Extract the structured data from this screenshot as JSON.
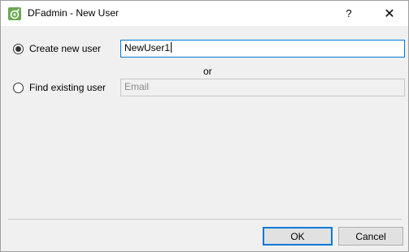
{
  "window": {
    "title": "DFadmin - New User",
    "help_glyph": "?",
    "close_glyph": "✕"
  },
  "options": {
    "create": {
      "label": "Create new user",
      "value": "NewUser1",
      "selected": true
    },
    "separator": "or",
    "find": {
      "label": "Find existing user",
      "placeholder": "Email",
      "selected": false
    }
  },
  "buttons": {
    "ok": "OK",
    "cancel": "Cancel"
  },
  "icons": {
    "app": "dfadmin-app-icon",
    "help": "help-icon",
    "close": "close-icon"
  },
  "colors": {
    "focus_border": "#0078d7",
    "app_icon_green": "#6aa84f"
  }
}
